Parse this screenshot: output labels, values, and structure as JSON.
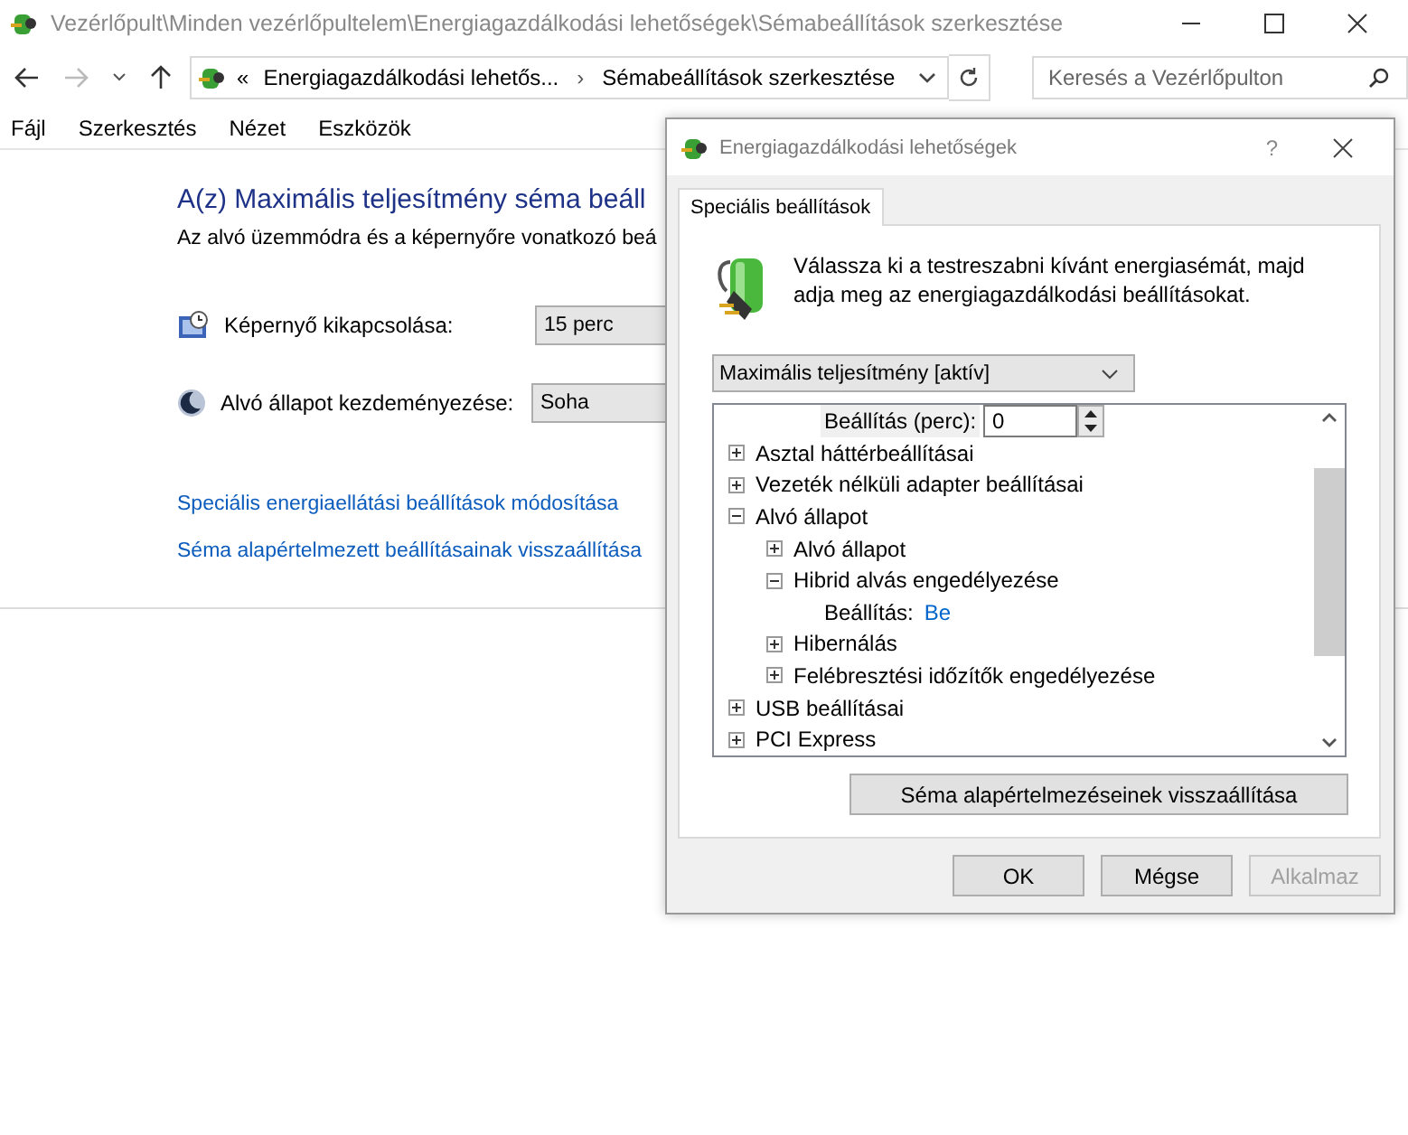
{
  "window": {
    "title": "Vezérlőpult\\Minden vezérlőpultelem\\Energiagazdálkodási lehetőségek\\Sémabeállítások szerkesztése"
  },
  "address": {
    "chevron": "«",
    "crumbs": [
      "Energiagazdálkodási lehetős...",
      "Sémabeállítások szerkesztése"
    ],
    "separator": "›"
  },
  "search": {
    "placeholder": "Keresés a Vezérlőpulton"
  },
  "menu": [
    "Fájl",
    "Szerkesztés",
    "Nézet",
    "Eszközök"
  ],
  "page": {
    "heading": "A(z) Maximális teljesítmény séma beáll",
    "description": "Az alvó üzemmódra és a képernyőre vonatkozó beá",
    "settings": [
      {
        "kind": "display",
        "label": "Képernyő kikapcsolása:",
        "value": "15 perc"
      },
      {
        "kind": "sleep",
        "label": "Alvó állapot kezdeményezése:",
        "value": "Soha"
      }
    ],
    "links": [
      "Speciális energiaellátási beállítások módosítása",
      "Séma alapértelmezett beállításainak visszaállítása"
    ]
  },
  "dialog": {
    "title": "Energiagazdálkodási lehetőségek",
    "help": "?",
    "tabs": [
      {
        "label": "Speciális beállítások",
        "selected": true
      }
    ],
    "intro": "Válassza ki a testreszabni kívánt energiasémát, majd adja meg az energiagazdálkodási beállításokat.",
    "plan": "Maximális teljesítmény [aktív]",
    "tree": [
      {
        "kind": "spin",
        "label": "Beállítás (perc):",
        "value": "0"
      },
      {
        "kind": "node",
        "label": "Asztal háttérbeállításai",
        "expanded": false
      },
      {
        "kind": "node",
        "label": "Vezeték nélküli adapter beállításai",
        "expanded": false
      },
      {
        "kind": "node",
        "label": "Alvó állapot",
        "expanded": true,
        "children": [
          {
            "kind": "node",
            "label": "Alvó állapot",
            "expanded": false
          },
          {
            "kind": "node",
            "label": "Hibrid alvás engedélyezése",
            "expanded": true,
            "children": [
              {
                "kind": "link",
                "label": "Beállítás:",
                "value": "Be"
              }
            ]
          },
          {
            "kind": "node",
            "label": "Hibernálás",
            "expanded": false
          },
          {
            "kind": "node",
            "label": "Felébresztési időzítők engedélyezése",
            "expanded": false
          }
        ]
      },
      {
        "kind": "node",
        "label": "USB beállításai",
        "expanded": false
      },
      {
        "kind": "node",
        "label": "PCI Express",
        "expanded": false
      }
    ],
    "reset": "Séma alapértelmezéseinek visszaállítása",
    "buttons": [
      {
        "label": "OK",
        "disabled": false
      },
      {
        "label": "Mégse",
        "disabled": false
      },
      {
        "label": "Alkalmaz",
        "disabled": true
      }
    ]
  }
}
